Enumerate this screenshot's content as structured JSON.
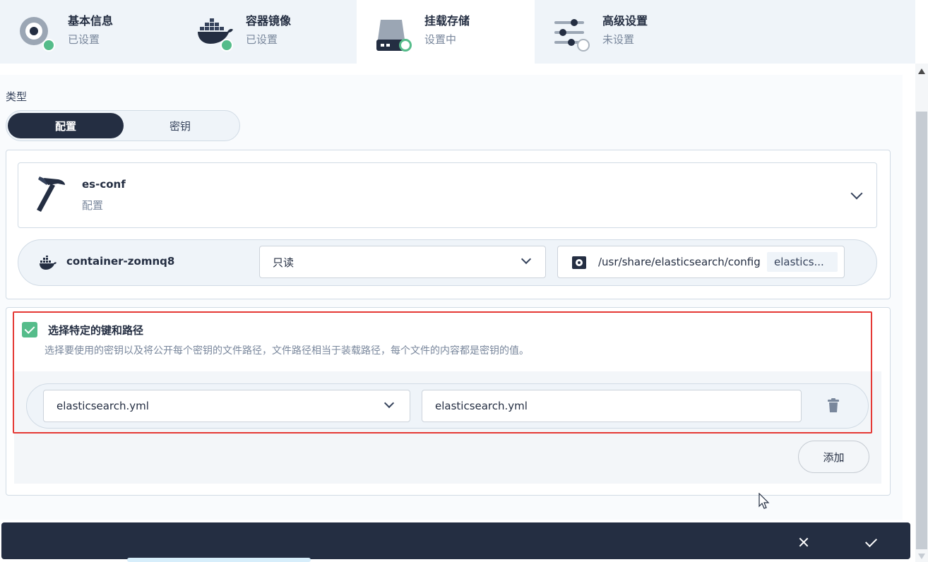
{
  "steps": [
    {
      "title": "基本信息",
      "status": "已设置",
      "icon": "basic-info-icon",
      "state": "done"
    },
    {
      "title": "容器镜像",
      "status": "已设置",
      "icon": "docker-icon",
      "state": "done"
    },
    {
      "title": "挂载存储",
      "status": "设置中",
      "icon": "storage-icon",
      "state": "doing"
    },
    {
      "title": "高级设置",
      "status": "未设置",
      "icon": "sliders-icon",
      "state": "todo"
    }
  ],
  "form": {
    "type_label": "类型",
    "type_options": [
      "配置",
      "密钥"
    ],
    "type_selected": "配置"
  },
  "config": {
    "name": "es-conf",
    "kind": "配置",
    "icon": "hammer-icon"
  },
  "mount": {
    "container": "container-zomnq8",
    "access_mode": "只读",
    "path": "/usr/share/elasticsearch/config",
    "path_tag": "elastics..."
  },
  "key_path": {
    "checkbox_label": "选择特定的键和路径",
    "checked": true,
    "description": "选择要使用的密钥以及将公开每个密钥的文件路径，文件路径相当于装载路径，每个文件的内容都是密钥的值。",
    "key": "elasticsearch.yml",
    "path": "elasticsearch.yml",
    "add_label": "添加"
  },
  "colors": {
    "dark": "#242e42",
    "green": "#55bc8a",
    "highlight": "#e53935",
    "muted": "#79879c"
  }
}
